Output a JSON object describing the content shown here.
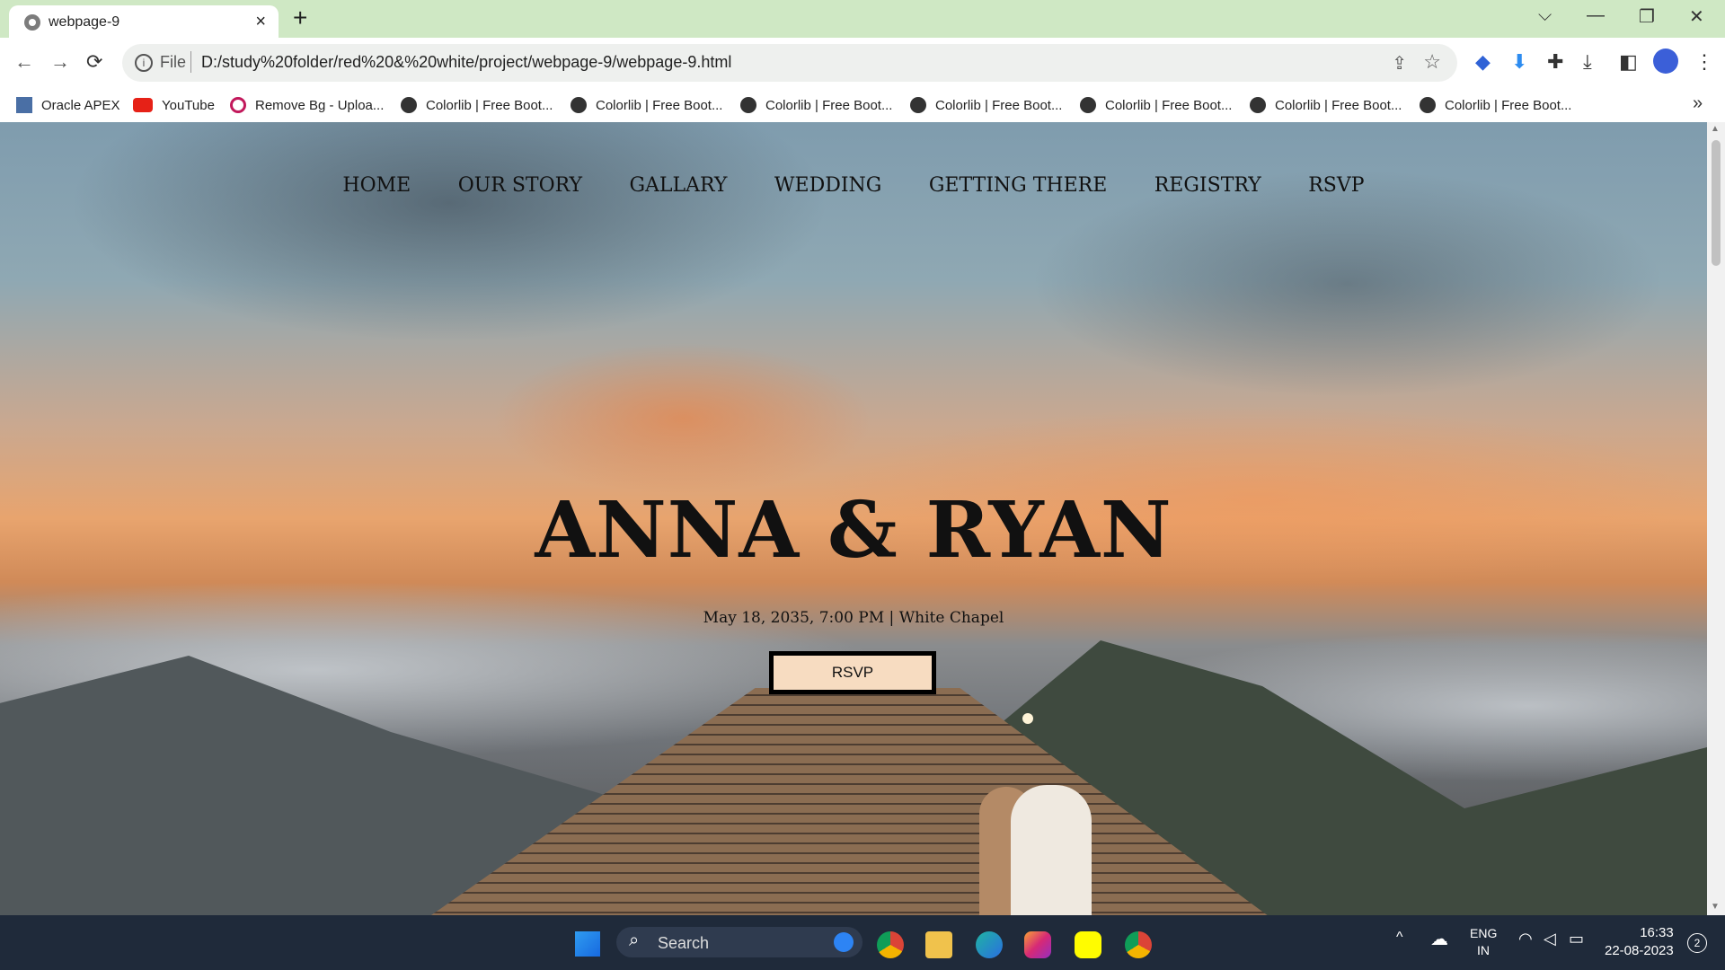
{
  "browser": {
    "tab_title": "webpage-9",
    "tab_close": "×",
    "new_tab": "+",
    "window": {
      "tabs_list": "⌵",
      "minimize": "—",
      "restore": "❐",
      "close": "✕"
    },
    "nav": {
      "back": "←",
      "forward": "→",
      "reload": "⟳"
    },
    "omnibox": {
      "info_glyph": "i",
      "scheme": "File",
      "url": "D:/study%20folder/red%20&%20white/project/webpage-9/webpage-9.html",
      "share_glyph": "⇪",
      "star_glyph": "☆"
    },
    "extensions": {
      "ext1": "◆",
      "ext2": "⬇",
      "puzzle": "✚",
      "download": "⤓",
      "sidepanel": "◧",
      "menu": "⋮"
    },
    "bookmarks": [
      {
        "label": "Oracle APEX",
        "icon": "apex-icon"
      },
      {
        "label": "YouTube",
        "icon": "youtube-icon"
      },
      {
        "label": "Remove Bg - Uploa...",
        "icon": "removebg-icon"
      },
      {
        "label": "Colorlib | Free Boot...",
        "icon": "globe-icon"
      },
      {
        "label": "Colorlib | Free Boot...",
        "icon": "globe-icon"
      },
      {
        "label": "Colorlib | Free Boot...",
        "icon": "globe-icon"
      },
      {
        "label": "Colorlib | Free Boot...",
        "icon": "globe-icon"
      },
      {
        "label": "Colorlib | Free Boot...",
        "icon": "globe-icon"
      },
      {
        "label": "Colorlib | Free Boot...",
        "icon": "globe-icon"
      },
      {
        "label": "Colorlib | Free Boot...",
        "icon": "globe-icon"
      }
    ],
    "bookmarks_more": "»"
  },
  "page": {
    "nav": [
      "HOME",
      "OUR STORY",
      "GALLARY",
      "WEDDING",
      "GETTING THERE",
      "REGISTRY",
      "RSVP"
    ],
    "hero_title": "ANNA & RYAN",
    "hero_subtitle": "May 18, 2035, 7:00 PM | White Chapel",
    "rsvp_button": "RSVP"
  },
  "taskbar": {
    "search_icon": "⌕",
    "search_label": "Search",
    "tray": {
      "chevron": "^",
      "cloud": "☁",
      "lang1": "ENG",
      "lang2": "IN",
      "wifi": "◠",
      "volume": "◁",
      "battery": "▭"
    },
    "time": "16:33",
    "date": "22-08-2023",
    "notifications": "2"
  },
  "colors": {
    "tab_strip": "#cfe8c4",
    "taskbar": "#1f2a3a",
    "rsvp_fill": "#f7dcc1"
  }
}
